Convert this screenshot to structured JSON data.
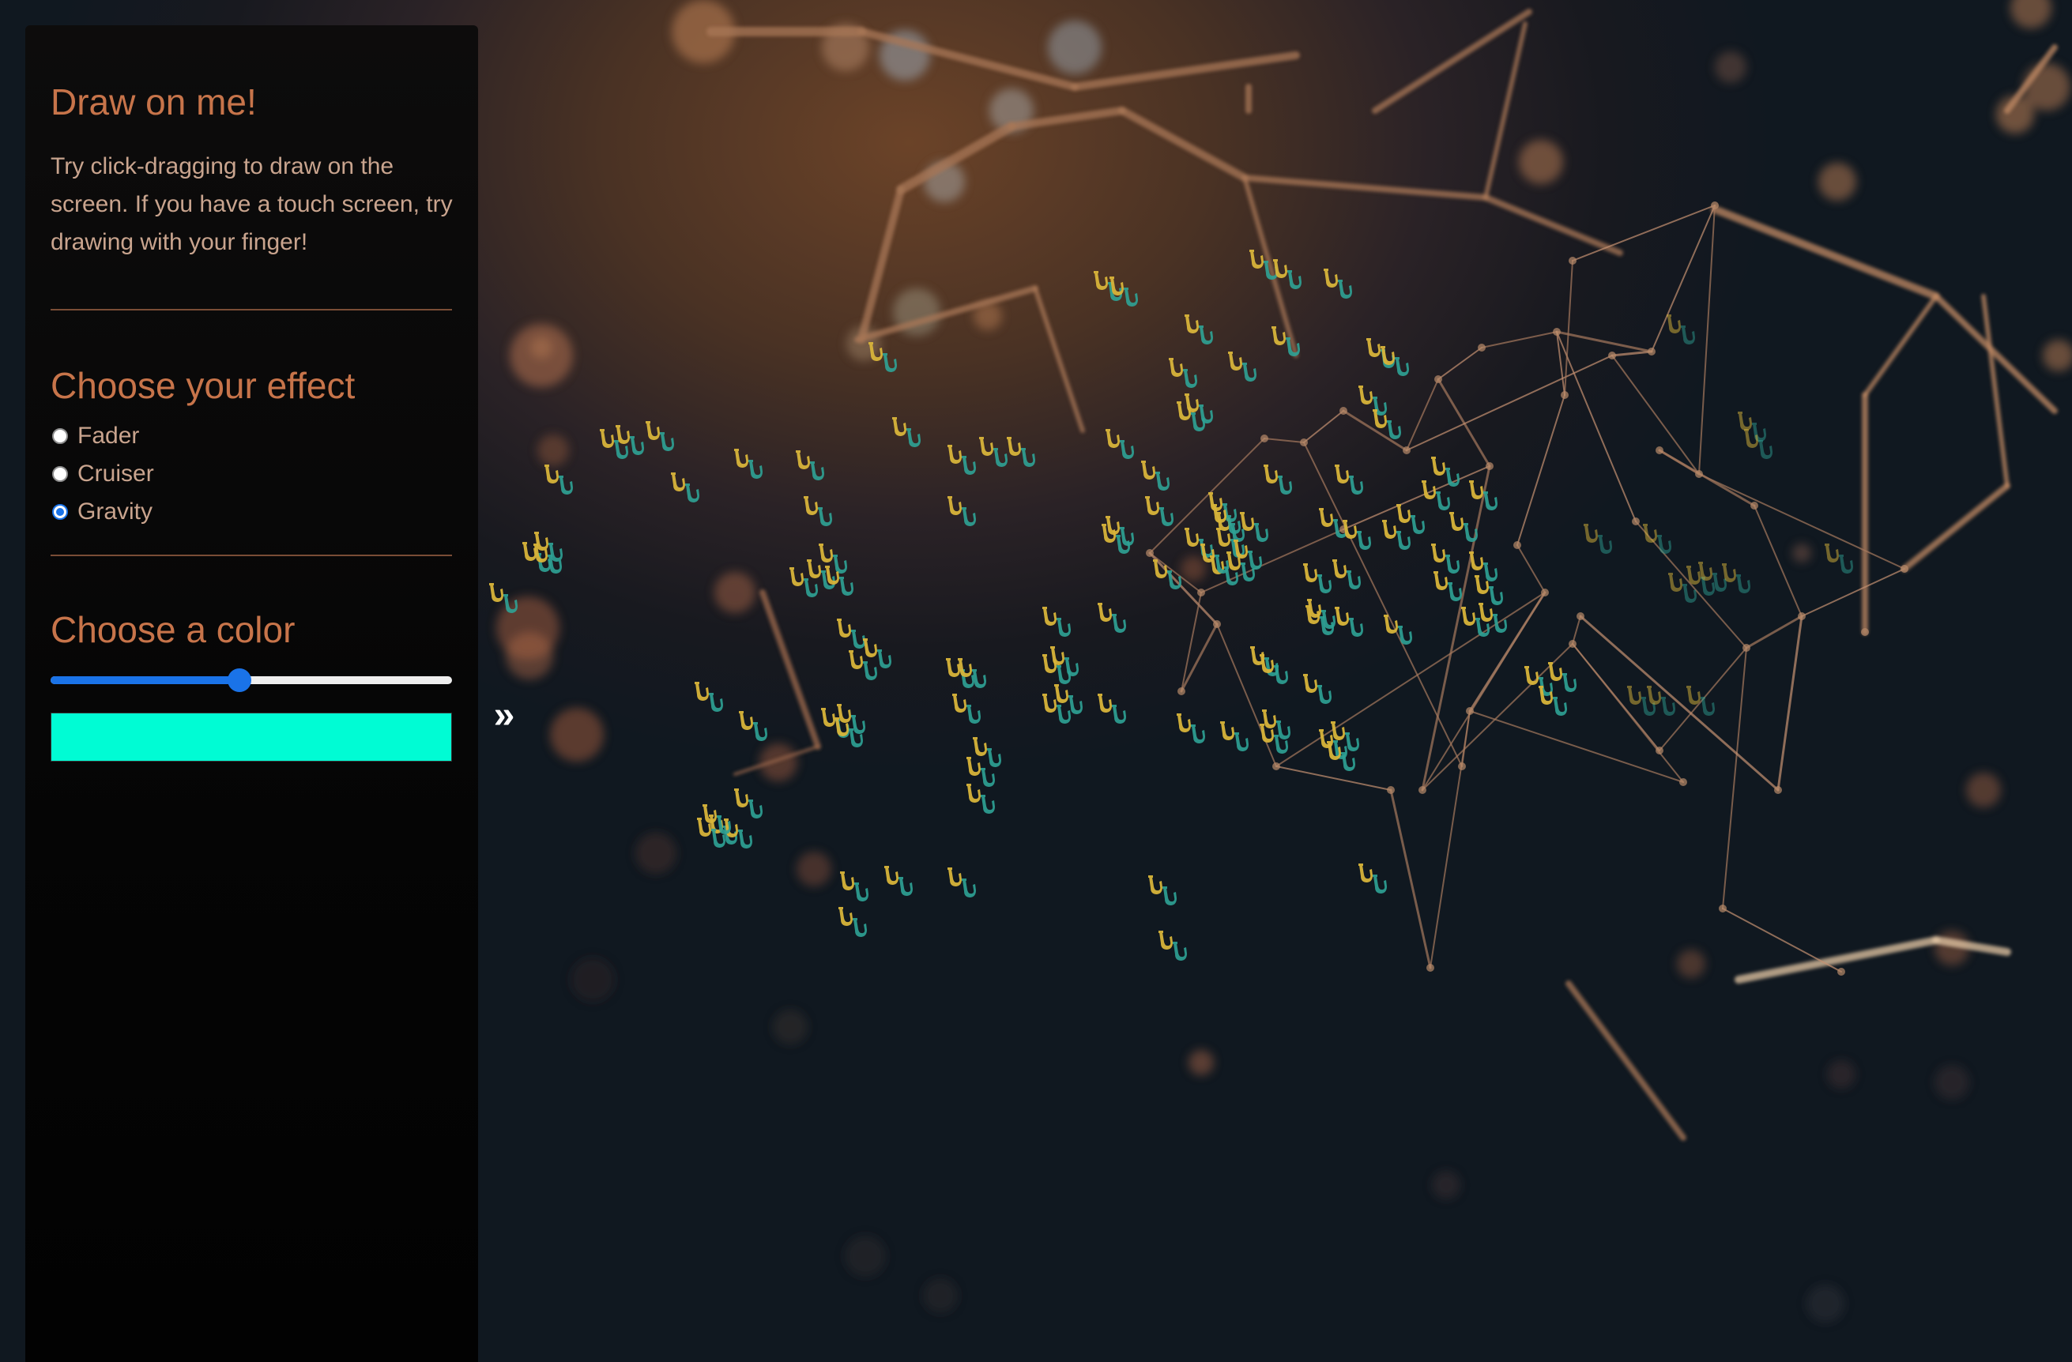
{
  "panel": {
    "title": "Draw on me!",
    "description": "Try click-dragging to draw on the screen. If you have a touch screen, try drawing with your finger!",
    "effect_title": "Choose your effect",
    "effects": [
      {
        "label": "Fader",
        "checked": false
      },
      {
        "label": "Cruiser",
        "checked": false
      },
      {
        "label": "Gravity",
        "checked": true
      }
    ],
    "color_title": "Choose a color",
    "hue_slider_value": 0.47,
    "selected_color": "#00fcd4"
  },
  "toggle": {
    "icon": "double-chevron-right-icon",
    "glyph": "»"
  },
  "colors": {
    "accent": "#c7744a",
    "text": "#c9a48e",
    "slider": "#1a73e8",
    "sax_gold": "#d9b53a",
    "sax_teal": "#2fa396"
  }
}
